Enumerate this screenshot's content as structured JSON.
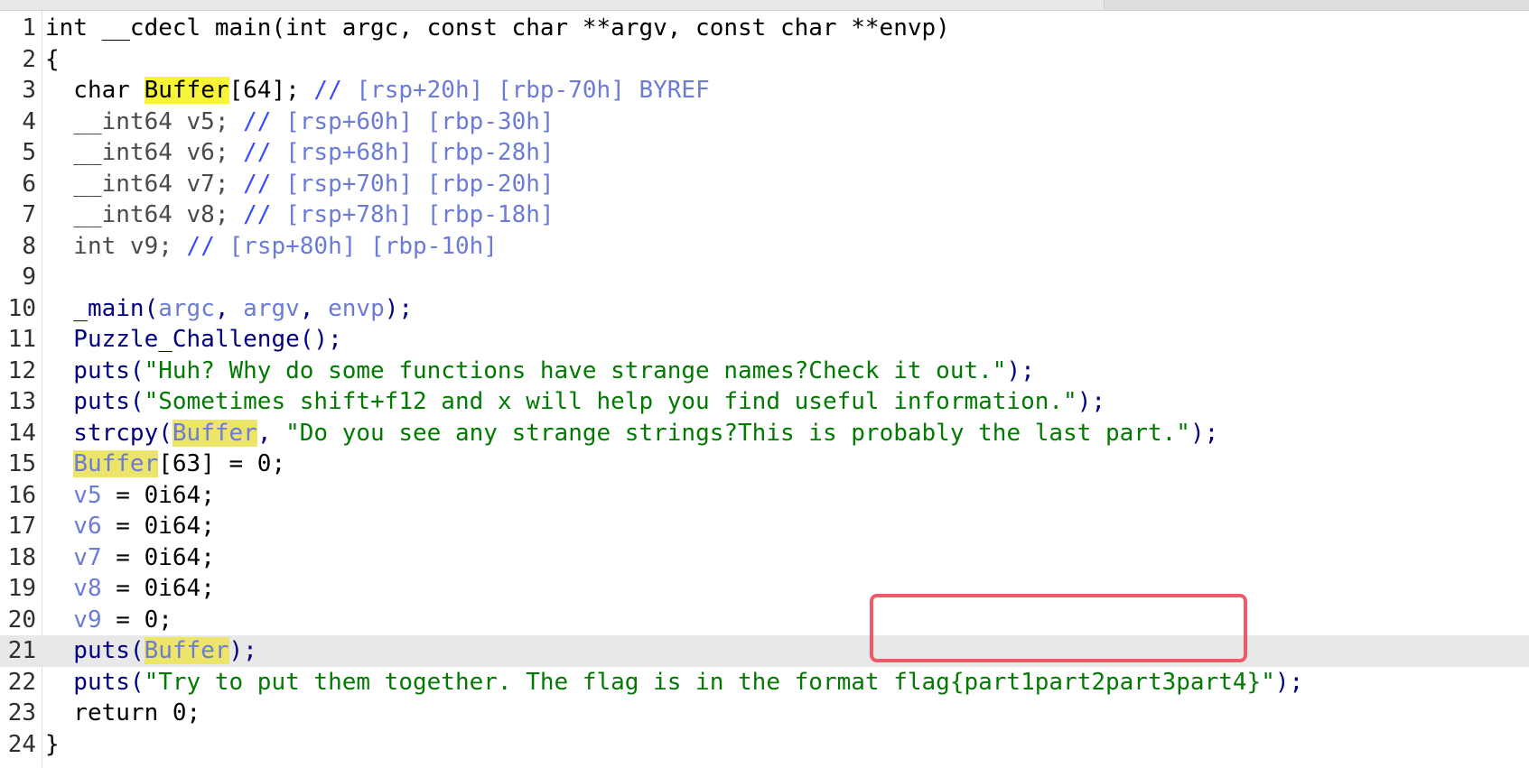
{
  "editor": {
    "lines": [
      {
        "n": "1",
        "tokens": [
          {
            "t": "int __cdecl main(int argc, const char **argv, const char **envp)",
            "c": "def"
          }
        ]
      },
      {
        "n": "2",
        "tokens": [
          {
            "t": "{",
            "c": "def"
          }
        ]
      },
      {
        "n": "3",
        "tokens": [
          {
            "t": "  char ",
            "c": "def"
          },
          {
            "t": "Buffer",
            "c": "def hl"
          },
          {
            "t": "[64]; ",
            "c": "def"
          },
          {
            "t": "// ",
            "c": "cm"
          },
          {
            "t": "[rsp+20h] [rbp-70h] BYREF",
            "c": "cm2"
          }
        ]
      },
      {
        "n": "4",
        "tokens": [
          {
            "t": "  __int64 v5; ",
            "c": "ty"
          },
          {
            "t": "// ",
            "c": "cm"
          },
          {
            "t": "[rsp+60h] [rbp-30h]",
            "c": "cm2"
          }
        ]
      },
      {
        "n": "5",
        "tokens": [
          {
            "t": "  __int64 v6; ",
            "c": "ty"
          },
          {
            "t": "// ",
            "c": "cm"
          },
          {
            "t": "[rsp+68h] [rbp-28h]",
            "c": "cm2"
          }
        ]
      },
      {
        "n": "6",
        "tokens": [
          {
            "t": "  __int64 v7; ",
            "c": "ty"
          },
          {
            "t": "// ",
            "c": "cm"
          },
          {
            "t": "[rsp+70h] [rbp-20h]",
            "c": "cm2"
          }
        ]
      },
      {
        "n": "7",
        "tokens": [
          {
            "t": "  __int64 v8; ",
            "c": "ty"
          },
          {
            "t": "// ",
            "c": "cm"
          },
          {
            "t": "[rsp+78h] [rbp-18h]",
            "c": "cm2"
          }
        ]
      },
      {
        "n": "8",
        "tokens": [
          {
            "t": "  int v9; ",
            "c": "ty"
          },
          {
            "t": "// ",
            "c": "cm"
          },
          {
            "t": "[rsp+80h] [rbp-10h]",
            "c": "cm2"
          }
        ]
      },
      {
        "n": "9",
        "tokens": []
      },
      {
        "n": "10",
        "tokens": [
          {
            "t": "  _main(",
            "c": "fn"
          },
          {
            "t": "argc",
            "c": "var"
          },
          {
            "t": ", ",
            "c": "fn"
          },
          {
            "t": "argv",
            "c": "var"
          },
          {
            "t": ", ",
            "c": "fn"
          },
          {
            "t": "envp",
            "c": "var"
          },
          {
            "t": ");",
            "c": "fn"
          }
        ]
      },
      {
        "n": "11",
        "tokens": [
          {
            "t": "  Puzzle_Challenge();",
            "c": "fn"
          }
        ]
      },
      {
        "n": "12",
        "tokens": [
          {
            "t": "  puts(",
            "c": "fn"
          },
          {
            "t": "\"Huh? Why do some functions have strange names?Check it out.\"",
            "c": "str"
          },
          {
            "t": ");",
            "c": "fn"
          }
        ]
      },
      {
        "n": "13",
        "tokens": [
          {
            "t": "  puts(",
            "c": "fn"
          },
          {
            "t": "\"Sometimes shift+f12 and x will help you find useful information.\"",
            "c": "str"
          },
          {
            "t": ");",
            "c": "fn"
          }
        ]
      },
      {
        "n": "14",
        "tokens": [
          {
            "t": "  strcpy(",
            "c": "fn"
          },
          {
            "t": "Buffer",
            "c": "var hl2"
          },
          {
            "t": ", ",
            "c": "fn"
          },
          {
            "t": "\"Do you see any strange strings?This is probably the last part.\"",
            "c": "str"
          },
          {
            "t": ");",
            "c": "fn"
          }
        ]
      },
      {
        "n": "15",
        "tokens": [
          {
            "t": "  ",
            "c": "def"
          },
          {
            "t": "Buffer",
            "c": "var hl2"
          },
          {
            "t": "[63] = 0;",
            "c": "def"
          }
        ]
      },
      {
        "n": "16",
        "tokens": [
          {
            "t": "  v5",
            "c": "var"
          },
          {
            "t": " = 0i64;",
            "c": "def"
          }
        ]
      },
      {
        "n": "17",
        "tokens": [
          {
            "t": "  v6",
            "c": "var"
          },
          {
            "t": " = 0i64;",
            "c": "def"
          }
        ]
      },
      {
        "n": "18",
        "tokens": [
          {
            "t": "  v7",
            "c": "var"
          },
          {
            "t": " = 0i64;",
            "c": "def"
          }
        ]
      },
      {
        "n": "19",
        "tokens": [
          {
            "t": "  v8",
            "c": "var"
          },
          {
            "t": " = 0i64;",
            "c": "def"
          }
        ]
      },
      {
        "n": "20",
        "tokens": [
          {
            "t": "  v9",
            "c": "var"
          },
          {
            "t": " = 0;",
            "c": "def"
          }
        ]
      },
      {
        "n": "21",
        "current": true,
        "tokens": [
          {
            "t": "  puts(",
            "c": "fn"
          },
          {
            "t": "Buffer",
            "c": "var hl2"
          },
          {
            "t": ");",
            "c": "fn"
          }
        ]
      },
      {
        "n": "22",
        "tokens": [
          {
            "t": "  puts(",
            "c": "fn"
          },
          {
            "t": "\"Try to put them together. The flag is in the format flag{part1part2part3part4}\"",
            "c": "str"
          },
          {
            "t": ");",
            "c": "fn"
          }
        ]
      },
      {
        "n": "23",
        "tokens": [
          {
            "t": "  return 0;",
            "c": "def"
          }
        ]
      },
      {
        "n": "24",
        "tokens": [
          {
            "t": "}",
            "c": "def"
          }
        ]
      }
    ]
  },
  "colors": {
    "highlight_primary": "#f7f43a",
    "highlight_secondary": "#ece56a",
    "string": "#007a00",
    "comment": "#3a4aff",
    "function": "#000080",
    "annotation_box": "#ef5a6a"
  }
}
